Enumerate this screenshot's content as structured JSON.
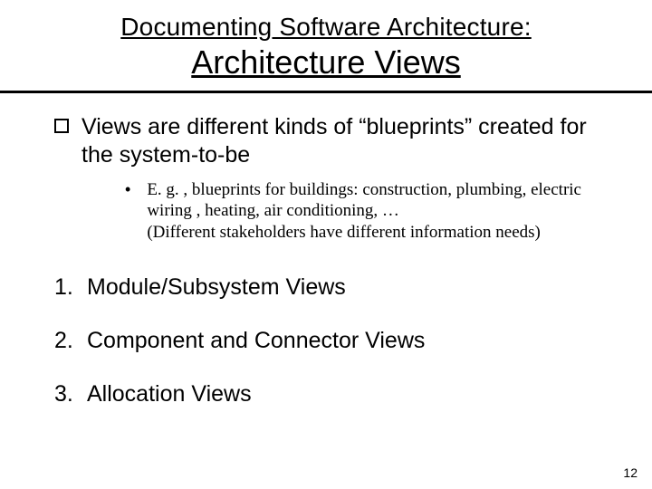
{
  "header": {
    "pretitle": "Documenting Software Architecture:",
    "title": "Architecture Views"
  },
  "body": {
    "main_bullet": "Views are different kinds of “blueprints” created for the system-to-be",
    "sub_bullet": "E. g. , blueprints for buildings: construction, plumbing, electric wiring , heating, air conditioning, …\n(Different stakeholders have different information needs)"
  },
  "numbered": [
    {
      "num": "1.",
      "text": "Module/Subsystem Views"
    },
    {
      "num": "2.",
      "text": "Component and Connector Views"
    },
    {
      "num": "3.",
      "text": "Allocation Views"
    }
  ],
  "page_number": "12"
}
